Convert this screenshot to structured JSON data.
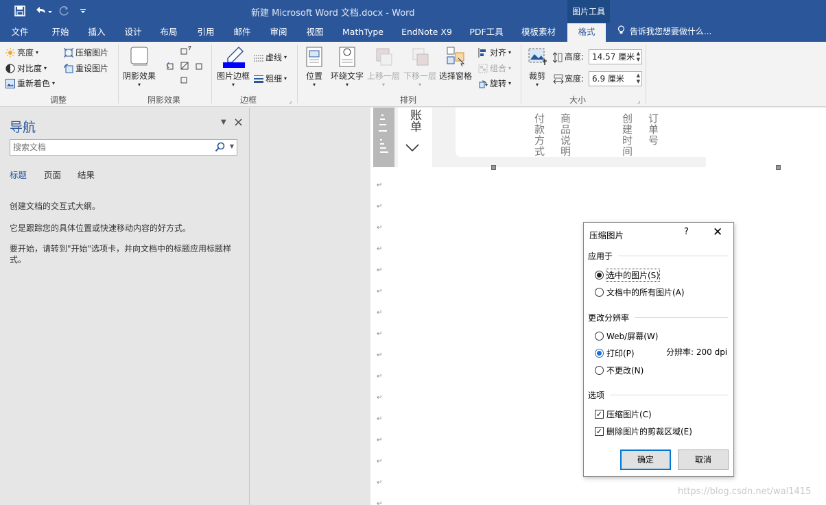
{
  "titlebar": {
    "doc_title": "新建 Microsoft Word 文档.docx - Word",
    "context_tab_title": "图片工具"
  },
  "tabs": [
    "文件",
    "开始",
    "插入",
    "设计",
    "布局",
    "引用",
    "邮件",
    "审阅",
    "视图",
    "MathType",
    "EndNote X9",
    "PDF工具",
    "模板素材",
    "格式"
  ],
  "tell_me": "告诉我您想要做什么...",
  "ribbon": {
    "adjust": {
      "brightness": "亮度",
      "contrast": "对比度",
      "recolor": "重新着色",
      "compress": "压缩图片",
      "reset": "重设图片",
      "label": "调整"
    },
    "shadow": {
      "button": "阴影效果",
      "label": "阴影效果"
    },
    "border": {
      "picture_border": "图片边框",
      "dashes": "虚线",
      "weight": "粗细",
      "label": "边框",
      "border_color": "#0000ff"
    },
    "arrange": {
      "position": "位置",
      "wrap": "环绕文字",
      "bring_forward": "上移一层",
      "send_backward": "下移一层",
      "selection_pane": "选择窗格",
      "align": "对齐",
      "group": "组合",
      "rotate": "旋转",
      "label": "排列"
    },
    "size": {
      "crop": "裁剪",
      "height_label": "高度:",
      "height_value": "14.57 厘米",
      "width_label": "宽度:",
      "width_value": "6.9 厘米",
      "label": "大小"
    }
  },
  "nav": {
    "title": "导航",
    "search_placeholder": "搜索文档",
    "tabs": [
      "标题",
      "页面",
      "结果"
    ],
    "text1": "创建文档的交互式大纲。",
    "text2": "它是跟踪您的具体位置或快速移动内容的好方式。",
    "text3": "要开始，请转到\"开始\"选项卡，并向文档中的标题应用标题样式。"
  },
  "doc_image": {
    "header_text": "账单",
    "col1": "付款方式",
    "col2": "商品说明",
    "col3": "创建时间",
    "col4": "订单号"
  },
  "dialog": {
    "title": "压缩图片",
    "help": "?",
    "apply_to_label": "应用于",
    "opt_selected": "选中的图片(S)",
    "opt_all": "文档中的所有图片(A)",
    "resolution_label": "更改分辨率",
    "opt_web": "Web/屏幕(W)",
    "opt_print": "打印(P)",
    "opt_nochange": "不更改(N)",
    "resolution_info": "分辨率:  200 dpi",
    "options_label": "选项",
    "chk_compress": "压缩图片(C)",
    "chk_delete_crop": "删除图片的剪裁区域(E)",
    "ok": "确定",
    "cancel": "取消"
  },
  "watermark": "https://blog.csdn.net/wal1415"
}
